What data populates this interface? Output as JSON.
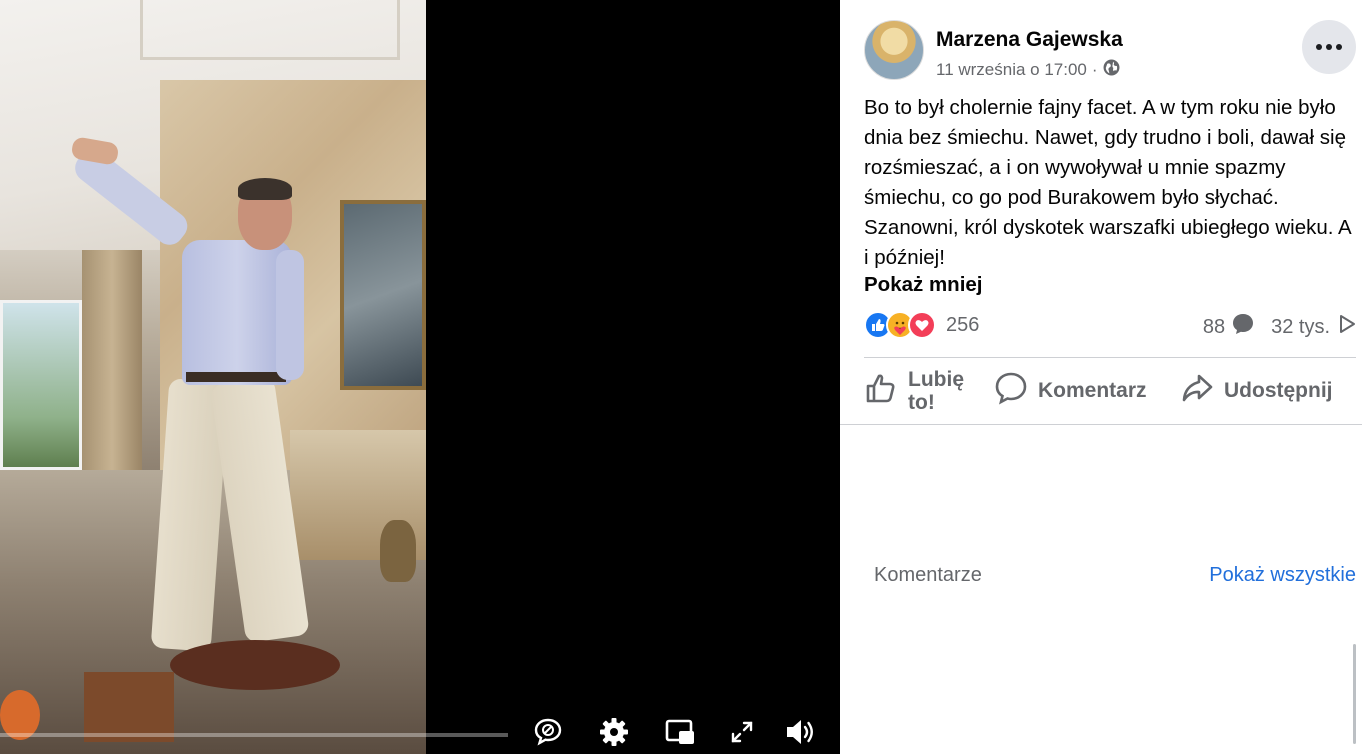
{
  "video": {
    "progress_fraction": 0.0,
    "controls": {
      "captions_icon": "captions-off-icon",
      "settings_icon": "gear-icon",
      "pip_icon": "picture-in-picture-icon",
      "fullscreen_icon": "fullscreen-icon",
      "volume_icon": "volume-icon"
    }
  },
  "post": {
    "author": "Marzena Gajewska",
    "date": "11 września o 17:00",
    "separator": "·",
    "privacy_icon": "globe-icon",
    "text": "Bo to był cholernie fajny facet. A w tym roku nie było dnia bez śmiechu. Nawet, gdy trudno i boli, dawał się rozśmieszać, a i on wywoływał u mnie spazmy śmiechu, co go pod Burakowem było słychać. Szanowni, król dyskotek warszafki ubiegłego wieku. A i później!",
    "show_less": "Pokaż mniej",
    "reactions": {
      "icons": [
        "like-icon",
        "care-icon",
        "love-icon"
      ],
      "count": "256"
    },
    "comments_count": "88",
    "views_count": "32 tys.",
    "actions": {
      "like_line1": "Lubię",
      "like_line2": "to!",
      "comment": "Komentarz",
      "share": "Udostępnij"
    },
    "comments_section": {
      "label": "Komentarze",
      "show_all": "Pokaż wszystkie"
    }
  },
  "colors": {
    "link_blue": "#216fdb",
    "secondary_text": "#65676b",
    "like_blue": "#1877f2",
    "love_red": "#f33e58"
  }
}
